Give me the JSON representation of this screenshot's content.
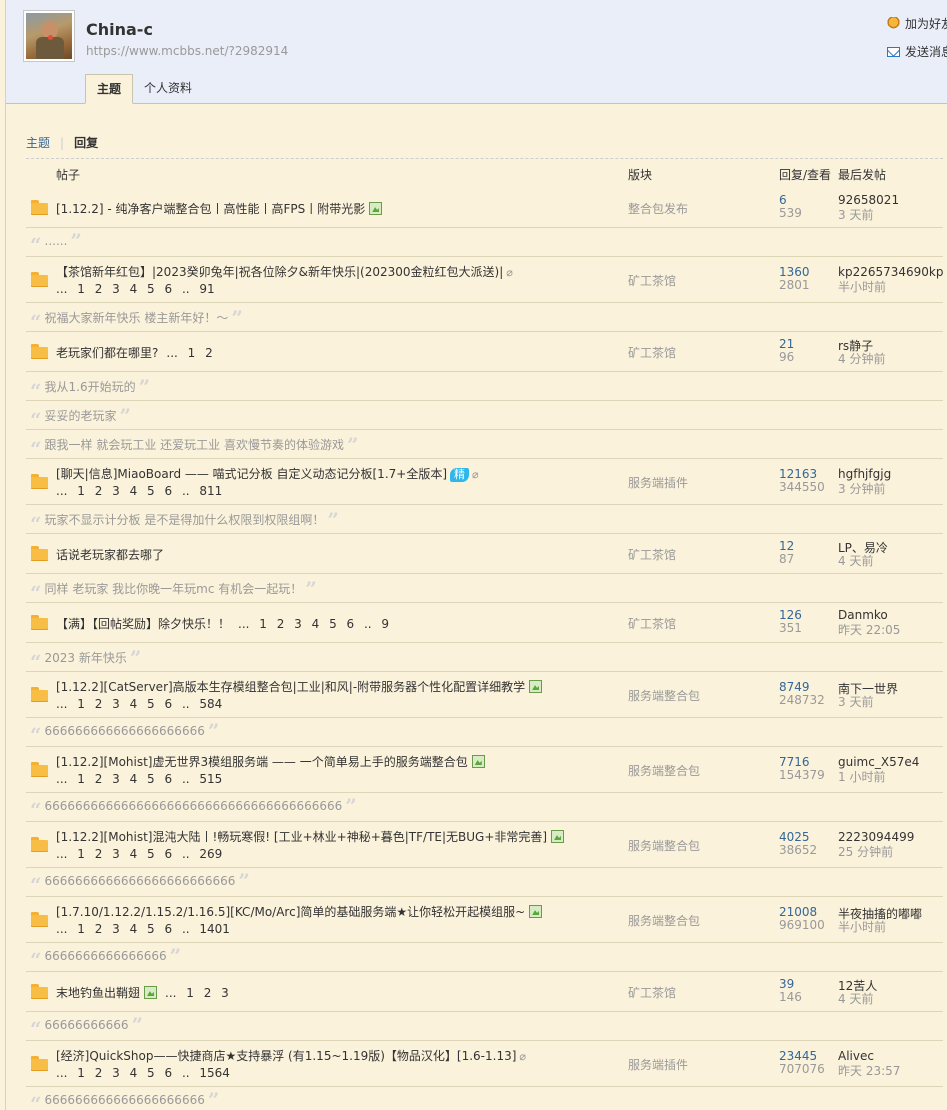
{
  "header": {
    "username": "China-c",
    "url": "https://www.mcbbs.net/?2982914",
    "add_friend": "加为好友",
    "send_message": "发送消息",
    "tabs": [
      "主题",
      "个人资料"
    ]
  },
  "subnav": {
    "topics": "主题",
    "sep": "|",
    "replies": "回复"
  },
  "columns": {
    "post": "帖子",
    "forum": "版块",
    "reply_view": "回复/查看",
    "last_post": "最后发帖"
  },
  "threads": [
    {
      "title": "[1.12.2] - 纯净客户端整合包丨高性能丨高FPS丨附带光影",
      "pages": "",
      "forum": "整合包发布",
      "replies": "6",
      "views": "539",
      "last_user": "92658021",
      "last_time": "3 天前",
      "quote": "......"
    },
    {
      "title": "【茶馆新年红包】|2023癸卯兔年|祝各位除夕&新年快乐|(202300金粒红包大派送)|",
      "pages": "... 1 2 3 4 5 6 .. 91",
      "forum": "矿工茶馆",
      "replies": "1360",
      "views": "2801",
      "last_user": "kp2265734690kp",
      "last_time": "半小时前",
      "quote": "祝福大家新年快乐 楼主新年好！～"
    },
    {
      "title": "老玩家们都在哪里?",
      "pages": "... 1 2",
      "forum": "矿工茶馆",
      "replies": "21",
      "views": "96",
      "last_user": "rs静子",
      "last_time": "4 分钟前",
      "quotes": [
        "我从1.6开始玩的",
        "妥妥的老玩家",
        "跟我一样 就会玩工业 还爱玩工业 喜欢慢节奏的体验游戏"
      ]
    },
    {
      "title": "[聊天|信息]MiaoBoard —— 喵式记分板 自定义动态记分板[1.7+全版本]",
      "jing": "精",
      "pages": "... 1 2 3 4 5 6 .. 811",
      "forum": "服务端插件",
      "replies": "12163",
      "views": "344550",
      "last_user": "hgfhjfgjg",
      "last_time": "3 分钟前",
      "quote": "玩家不显示计分板 是不是得加什么权限到权限组啊！"
    },
    {
      "title": "话说老玩家都去哪了",
      "pages": "",
      "forum": "矿工茶馆",
      "replies": "12",
      "views": "87",
      "last_user": "LP、易冷",
      "last_time": "4 天前",
      "quote": "同样 老玩家 我比你晚一年玩mc 有机会一起玩！"
    },
    {
      "title": "【满】【回帖奖励】除夕快乐！！",
      "pages": "... 1 2 3 4 5 6 .. 9",
      "forum": "矿工茶馆",
      "replies": "126",
      "views": "351",
      "last_user": "Danmko",
      "last_time": "昨天 22:05",
      "quote": "2023 新年快乐"
    },
    {
      "title": "[1.12.2][CatServer]高版本生存模组整合包|工业|和风|-附带服务器个性化配置详细教学",
      "pages": "... 1 2 3 4 5 6 .. 584",
      "forum": "服务端整合包",
      "replies": "8749",
      "views": "248732",
      "last_user": "南下一世界",
      "last_time": "3 天前",
      "quote": "666666666666666666666"
    },
    {
      "title": "[1.12.2][Mohist]虚无世界3模组服务端 —— 一个简单易上手的服务端整合包",
      "pages": "... 1 2 3 4 5 6 .. 515",
      "forum": "服务端整合包",
      "replies": "7716",
      "views": "154379",
      "last_user": "guimc_X57e4",
      "last_time": "1 小时前",
      "quote": "666666666666666666666666666666666666666"
    },
    {
      "title": "[1.12.2][Mohist]混沌大陆丨!畅玩寒假! [工业+林业+神秘+暮色|TF/TE|无BUG+非常完善]",
      "pages": "... 1 2 3 4 5 6 .. 269",
      "forum": "服务端整合包",
      "replies": "4025",
      "views": "38652",
      "last_user": "2223094499",
      "last_time": "25 分钟前",
      "quote": "6666666666666666666666666"
    },
    {
      "title": "[1.7.10/1.12.2/1.15.2/1.16.5][KC/Mo/Arc]简单的基础服务端★让你轻松开起模组服~",
      "pages": "... 1 2 3 4 5 6 .. 1401",
      "forum": "服务端整合包",
      "replies": "21008",
      "views": "969100",
      "last_user": "半夜抽搐的嘟嘟",
      "last_time": "半小时前",
      "quote": "6666666666666666"
    },
    {
      "title": "末地钓鱼出鞘翅",
      "pages": "... 1 2 3",
      "forum": "矿工茶馆",
      "replies": "39",
      "views": "146",
      "last_user": "12苦人",
      "last_time": "4 天前",
      "quote": "66666666666"
    },
    {
      "title": "[经济]QuickShop——快捷商店★支持暴浮 (有1.15~1.19版)【物品汉化】[1.6-1.13]",
      "pages": "... 1 2 3 4 5 6 .. 1564",
      "forum": "服务端插件",
      "replies": "23445",
      "views": "707076",
      "last_user": "Alivec",
      "last_time": "昨天 23:57",
      "quote": "666666666666666666666"
    }
  ]
}
